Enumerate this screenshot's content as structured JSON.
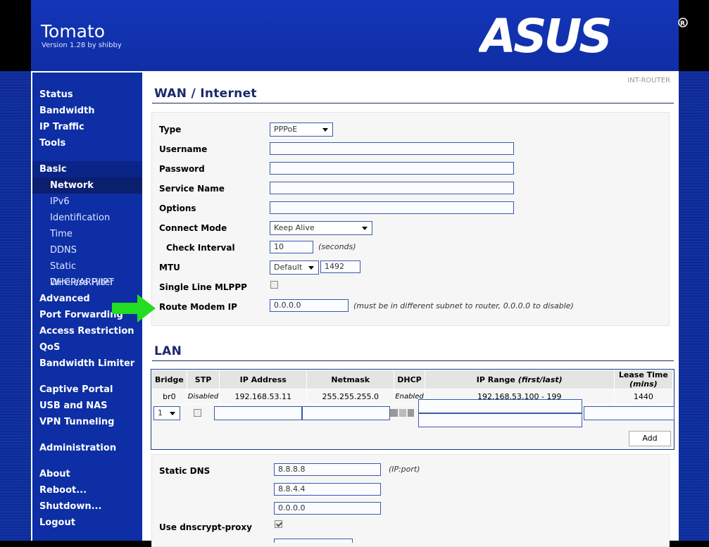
{
  "app": {
    "title": "Tomato",
    "version": "Version 1.28 by shibby",
    "router_name": "INT-ROUTER",
    "logo_text": "ASUS"
  },
  "nav": {
    "status": "Status",
    "bandwidth": "Bandwidth",
    "ip_traffic": "IP Traffic",
    "tools": "Tools",
    "basic": "Basic",
    "network": "Network",
    "ipv6": "IPv6",
    "identification": "Identification",
    "time": "Time",
    "ddns": "DDNS",
    "static_dhcp": "Static DHCP/ARP/IPT",
    "wireless_filter": "Wireless Filter",
    "advanced": "Advanced",
    "port_forwarding": "Port Forwarding",
    "access_restriction": "Access Restriction",
    "qos": "QoS",
    "bandwidth_limiter": "Bandwidth Limiter",
    "captive_portal": "Captive Portal",
    "usb_nas": "USB and NAS",
    "vpn": "VPN Tunneling",
    "administration": "Administration",
    "about": "About",
    "reboot": "Reboot...",
    "shutdown": "Shutdown...",
    "logout": "Logout"
  },
  "wan": {
    "title": "WAN / Internet",
    "type_label": "Type",
    "type_value": "PPPoE",
    "username_label": "Username",
    "username_value": "",
    "password_label": "Password",
    "password_value": "",
    "service_label": "Service Name",
    "service_value": "",
    "options_label": "Options",
    "options_value": "",
    "connect_label": "Connect Mode",
    "connect_value": "Keep Alive",
    "check_label": "Check Interval",
    "check_value": "10",
    "check_note": "(seconds)",
    "mtu_label": "MTU",
    "mtu_mode": "Default",
    "mtu_value": "1492",
    "mlppp_label": "Single Line MLPPP",
    "route_label": "Route Modem IP",
    "route_value": "0.0.0.0",
    "route_note": "(must be in different subnet to router, 0.0.0.0 to disable)"
  },
  "lan": {
    "title": "LAN",
    "headers": {
      "bridge": "Bridge",
      "stp": "STP",
      "ip": "IP Address",
      "netmask": "Netmask",
      "dhcp": "DHCP",
      "range": "IP Range",
      "range_note": "(first/last)",
      "lease": "Lease Time",
      "lease_note": "(mins)"
    },
    "row": {
      "bridge": "br0",
      "stp": "Disabled",
      "ip": "192.168.53.11",
      "netmask": "255.255.255.0",
      "dhcp": "Enabled",
      "range": "192.168.53.100 - 199",
      "lease": "1440"
    },
    "new_bridge": "1",
    "add_button": "Add"
  },
  "dns": {
    "static_label": "Static DNS",
    "dns1": "8.8.8.8",
    "dns2": "8.8.4.4",
    "dns3": "0.0.0.0",
    "ip_port_note": "(IP:port)",
    "dnscrypt_label": "Use dnscrypt-proxy"
  }
}
